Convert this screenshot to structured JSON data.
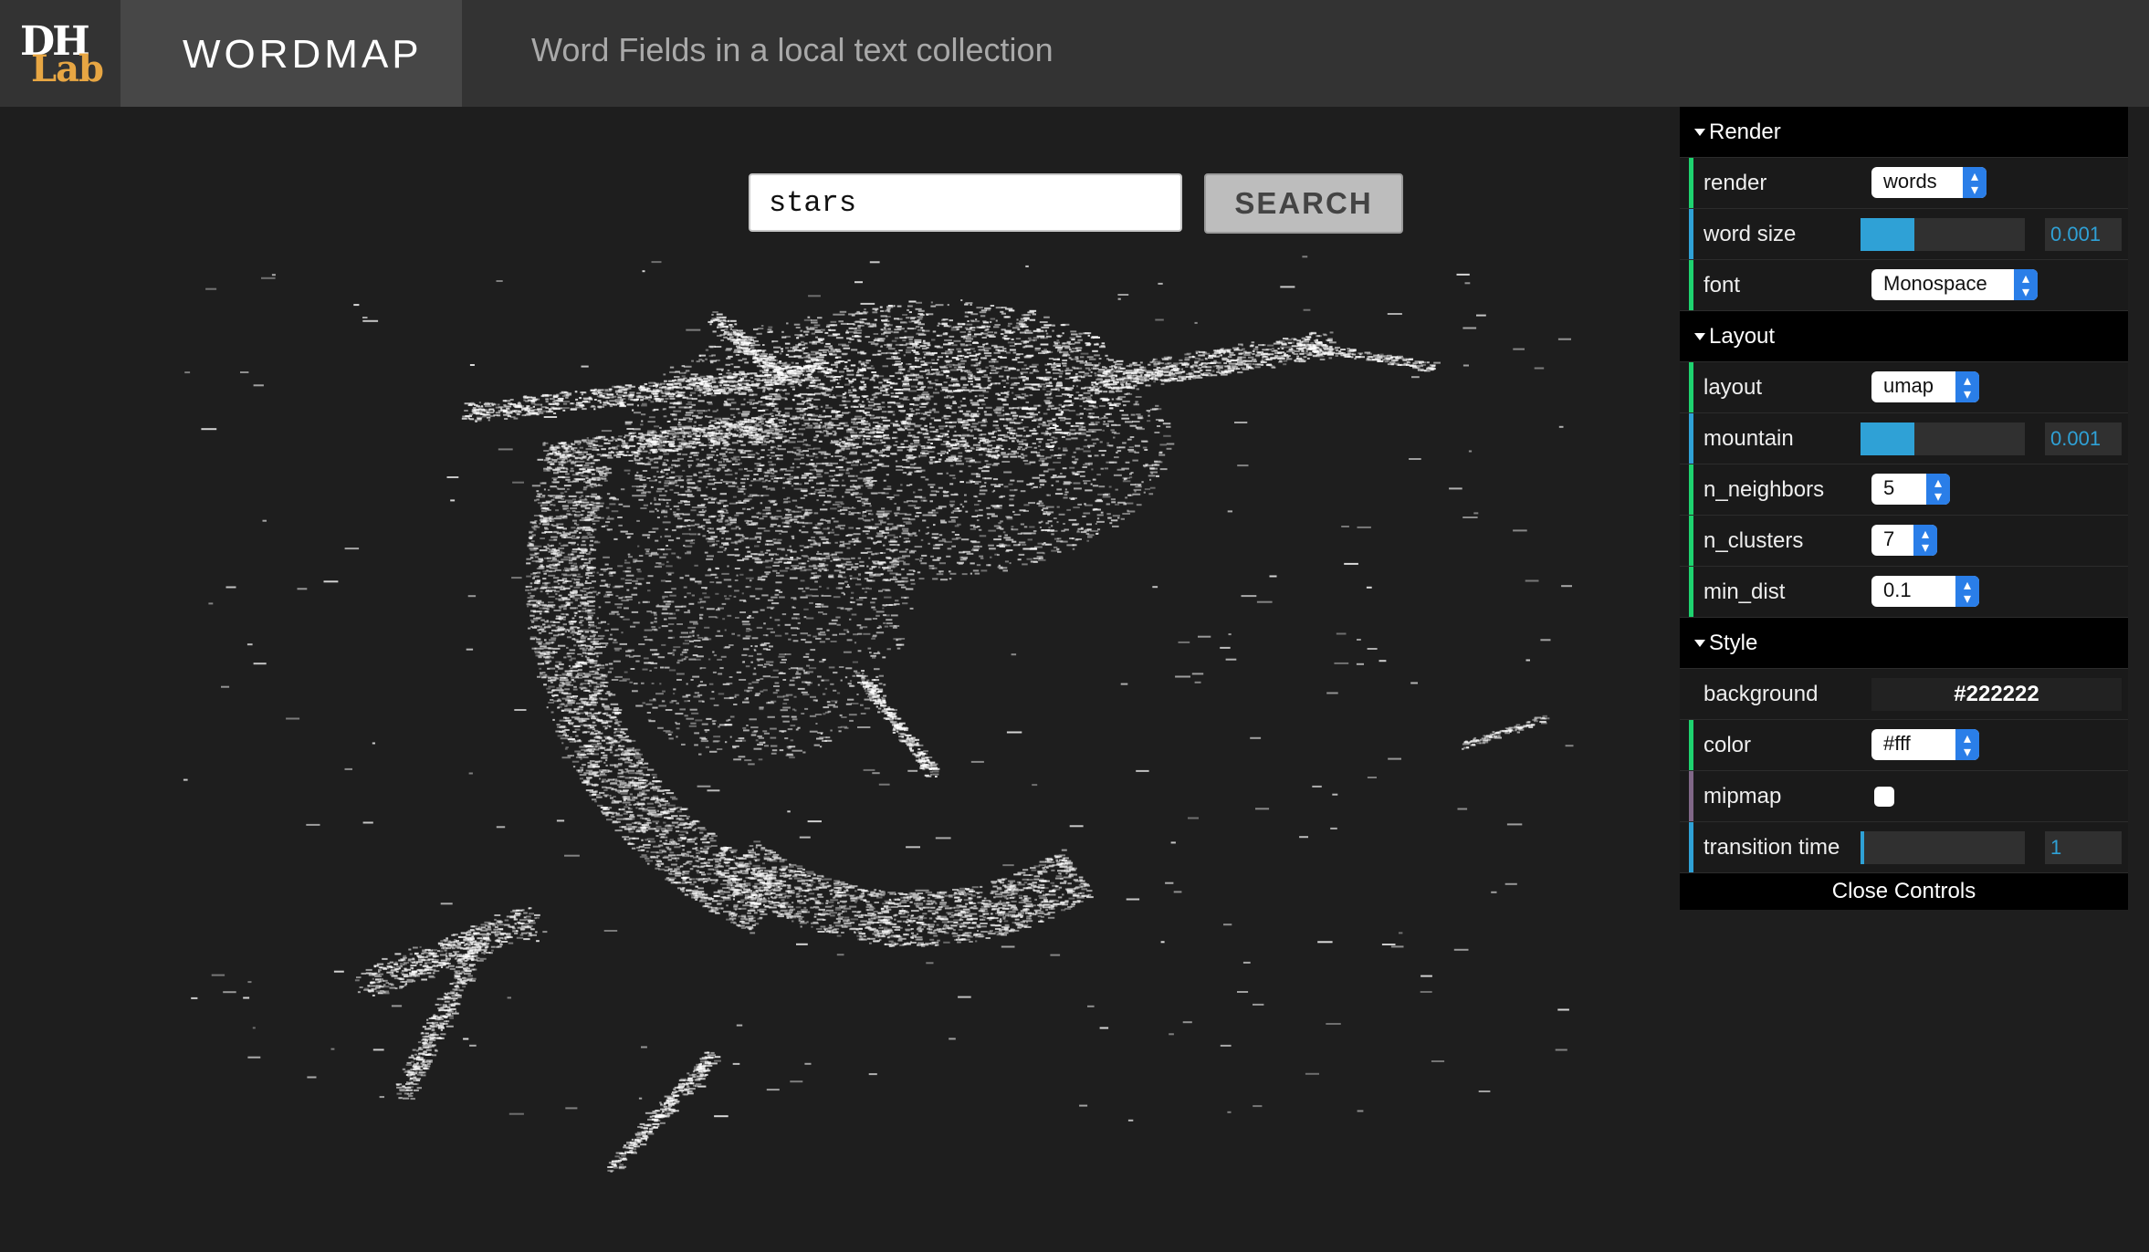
{
  "header": {
    "logo_top": "DH",
    "logo_bottom": "Lab",
    "app_title": "WORDMAP",
    "subtitle": "Word Fields in a local text collection"
  },
  "search": {
    "value": "stars",
    "button_label": "SEARCH"
  },
  "controls": {
    "render_folder": "Render",
    "render_label": "render",
    "render_value": "words",
    "word_size_label": "word size",
    "word_size_value": "0.001",
    "word_size_fraction": 0.33,
    "font_label": "font",
    "font_value": "Monospace",
    "layout_folder": "Layout",
    "layout_label": "layout",
    "layout_value": "umap",
    "mountain_label": "mountain",
    "mountain_value": "0.001",
    "mountain_fraction": 0.33,
    "n_neighbors_label": "n_neighbors",
    "n_neighbors_value": "5",
    "n_clusters_label": "n_clusters",
    "n_clusters_value": "7",
    "min_dist_label": "min_dist",
    "min_dist_value": "0.1",
    "style_folder": "Style",
    "background_label": "background",
    "background_value": "#222222",
    "color_label": "color",
    "color_value": "#fff",
    "mipmap_label": "mipmap",
    "mipmap_checked": false,
    "transition_label": "transition time",
    "transition_value": "1",
    "transition_fraction": 0.02,
    "close_label": "Close Controls"
  },
  "colors": {
    "background": "#1e1e1e",
    "header": "#333333",
    "accent_logo": "#e7a643",
    "slider": "#2fa1d6",
    "select_arrow": "#2a7ee8",
    "row_bar_green": "#1ed36f",
    "row_bar_blue": "#2fa1d6",
    "row_bar_purple": "#806787"
  }
}
